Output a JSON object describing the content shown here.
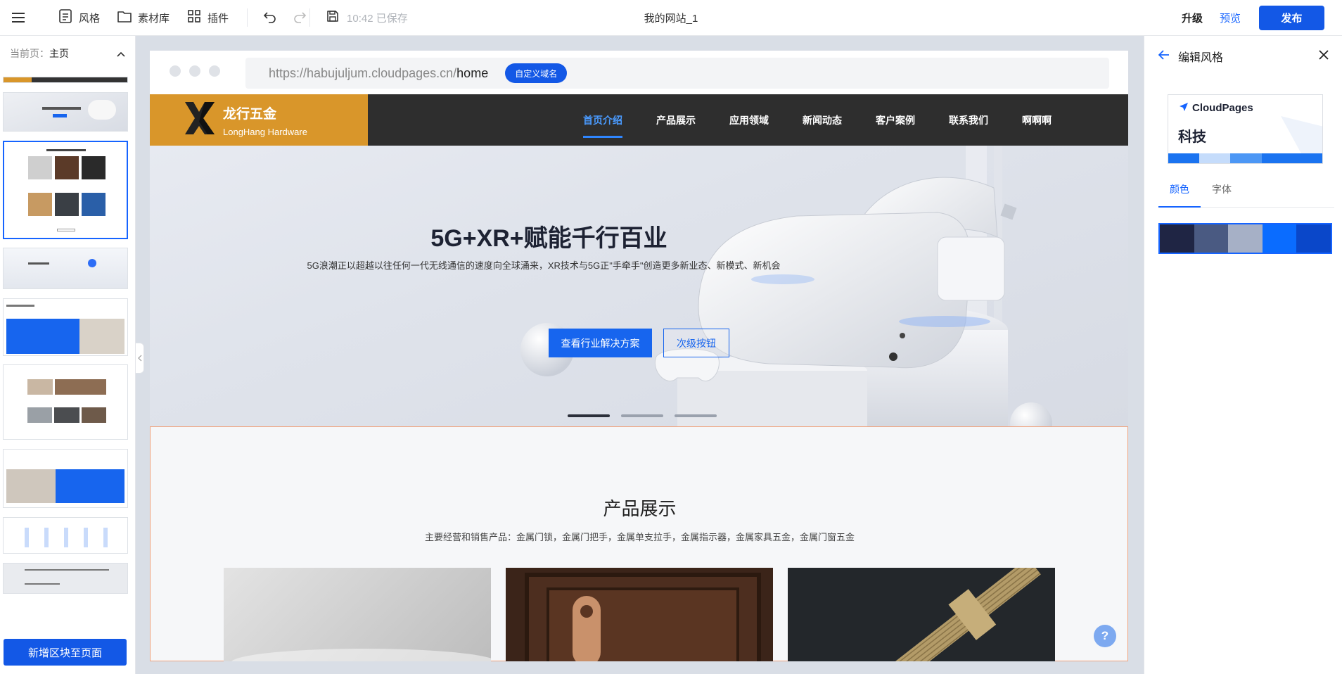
{
  "toolbar": {
    "style_label": "风格",
    "assets_label": "素材库",
    "plugins_label": "插件",
    "saved_status": "10:42 已保存",
    "site_title": "我的网站_1",
    "upgrade_label": "升级",
    "preview_label": "预览",
    "publish_label": "发布"
  },
  "left_panel": {
    "current_page_prefix": "当前页：",
    "current_page": "主页",
    "add_block_label": "新增区块至页面"
  },
  "canvas": {
    "url_prefix": "https://habujuljum.cloudpages.cn/",
    "url_path": "home",
    "custom_domain_label": "自定义域名",
    "brand_name": "龙行五金",
    "brand_subtitle": "LongHang Hardware",
    "nav_items": [
      "首页介绍",
      "产品展示",
      "应用领域",
      "新闻动态",
      "客户案例",
      "联系我们",
      "啊啊啊"
    ],
    "active_nav": 0,
    "hero_title": "5G+XR+赋能千行百业",
    "hero_subtitle": "5G浪潮正以超越以往任何一代无线通信的速度向全球涌来，XR技术与5G正\"手牵手\"创造更多新业态、新模式、新机会",
    "hero_primary_button": "查看行业解决方案",
    "hero_secondary_button": "次级按钮",
    "products_title": "产品展示",
    "products_subtitle": "主要经营和销售产品：金属门锁，金属门把手，金属单支拉手，金属指示器，金属家具五金，金属门窗五金",
    "help_label": "?"
  },
  "right_panel": {
    "title": "编辑风格",
    "card_brand": "CloudPages",
    "card_style_name": "科技",
    "tabs": [
      "颜色",
      "字体"
    ],
    "active_tab": 0,
    "palette": [
      "#1f2544",
      "#4a5a82",
      "#a6b0c6",
      "#0a6cff",
      "#0a47c9"
    ],
    "card_stripe": [
      "#1a73f0",
      "#c5dcfb",
      "#4c97f5",
      "#1a73f0",
      "#1a73f0"
    ]
  },
  "colors": {
    "primary": "#1358e6",
    "brand_orange": "#d9962a",
    "nav_dark": "#2e2e2e",
    "selection_outline": "#f0a37e"
  }
}
